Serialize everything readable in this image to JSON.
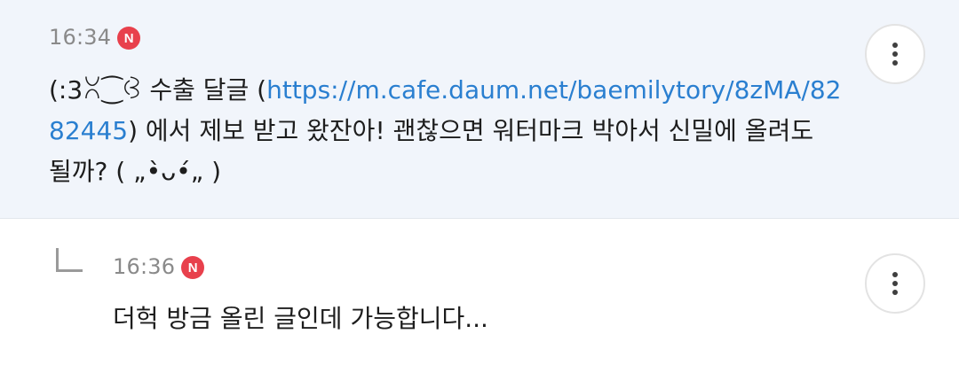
{
  "comments": [
    {
      "time": "16:34",
      "badge": "N",
      "text_pre": "(:3ꇤ⁐ꃳ 수출 달글 (",
      "link": "https://m.cafe.daum.net/baemilytory/8zMA/8282445",
      "link_line1": "https://m.cafe.daum.net/baemilytory/8zMA/82",
      "link_line2": "82445",
      "text_post_line2": ") 에서 제보 받고 왔잔아! 괜찮으면 워터마크 박아서 신밀에 올려도",
      "text_line3": "될까? ( „•̀ᴗ•́„ )"
    },
    {
      "time": "16:36",
      "badge": "N",
      "text": "더헉 방금 올린 글인데 가능합니다..."
    }
  ],
  "icons": {
    "more": "more-vertical-icon",
    "reply": "reply-arrow-icon",
    "new_badge": "new-badge-icon"
  },
  "colors": {
    "link": "#2a7fd0",
    "badge": "#e8404c",
    "highlight_bg": "#f1f5fb"
  }
}
